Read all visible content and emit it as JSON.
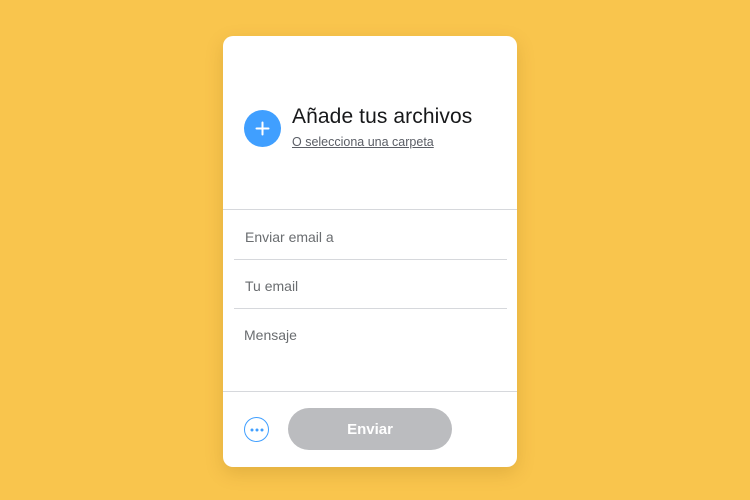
{
  "colors": {
    "background": "#F9C54D",
    "card": "#FFFFFF",
    "accent": "#409FFF",
    "send_button_disabled": "#BBBCBF",
    "divider": "#D6D8DC"
  },
  "upload": {
    "add_icon": "plus-icon",
    "title": "Añade tus archivos",
    "folder_link": "O selecciona una carpeta"
  },
  "form": {
    "recipient_placeholder": "Enviar email a",
    "sender_placeholder": "Tu email",
    "message_placeholder": "Mensaje"
  },
  "footer": {
    "more_icon": "more-options-icon",
    "send_label": "Enviar"
  }
}
